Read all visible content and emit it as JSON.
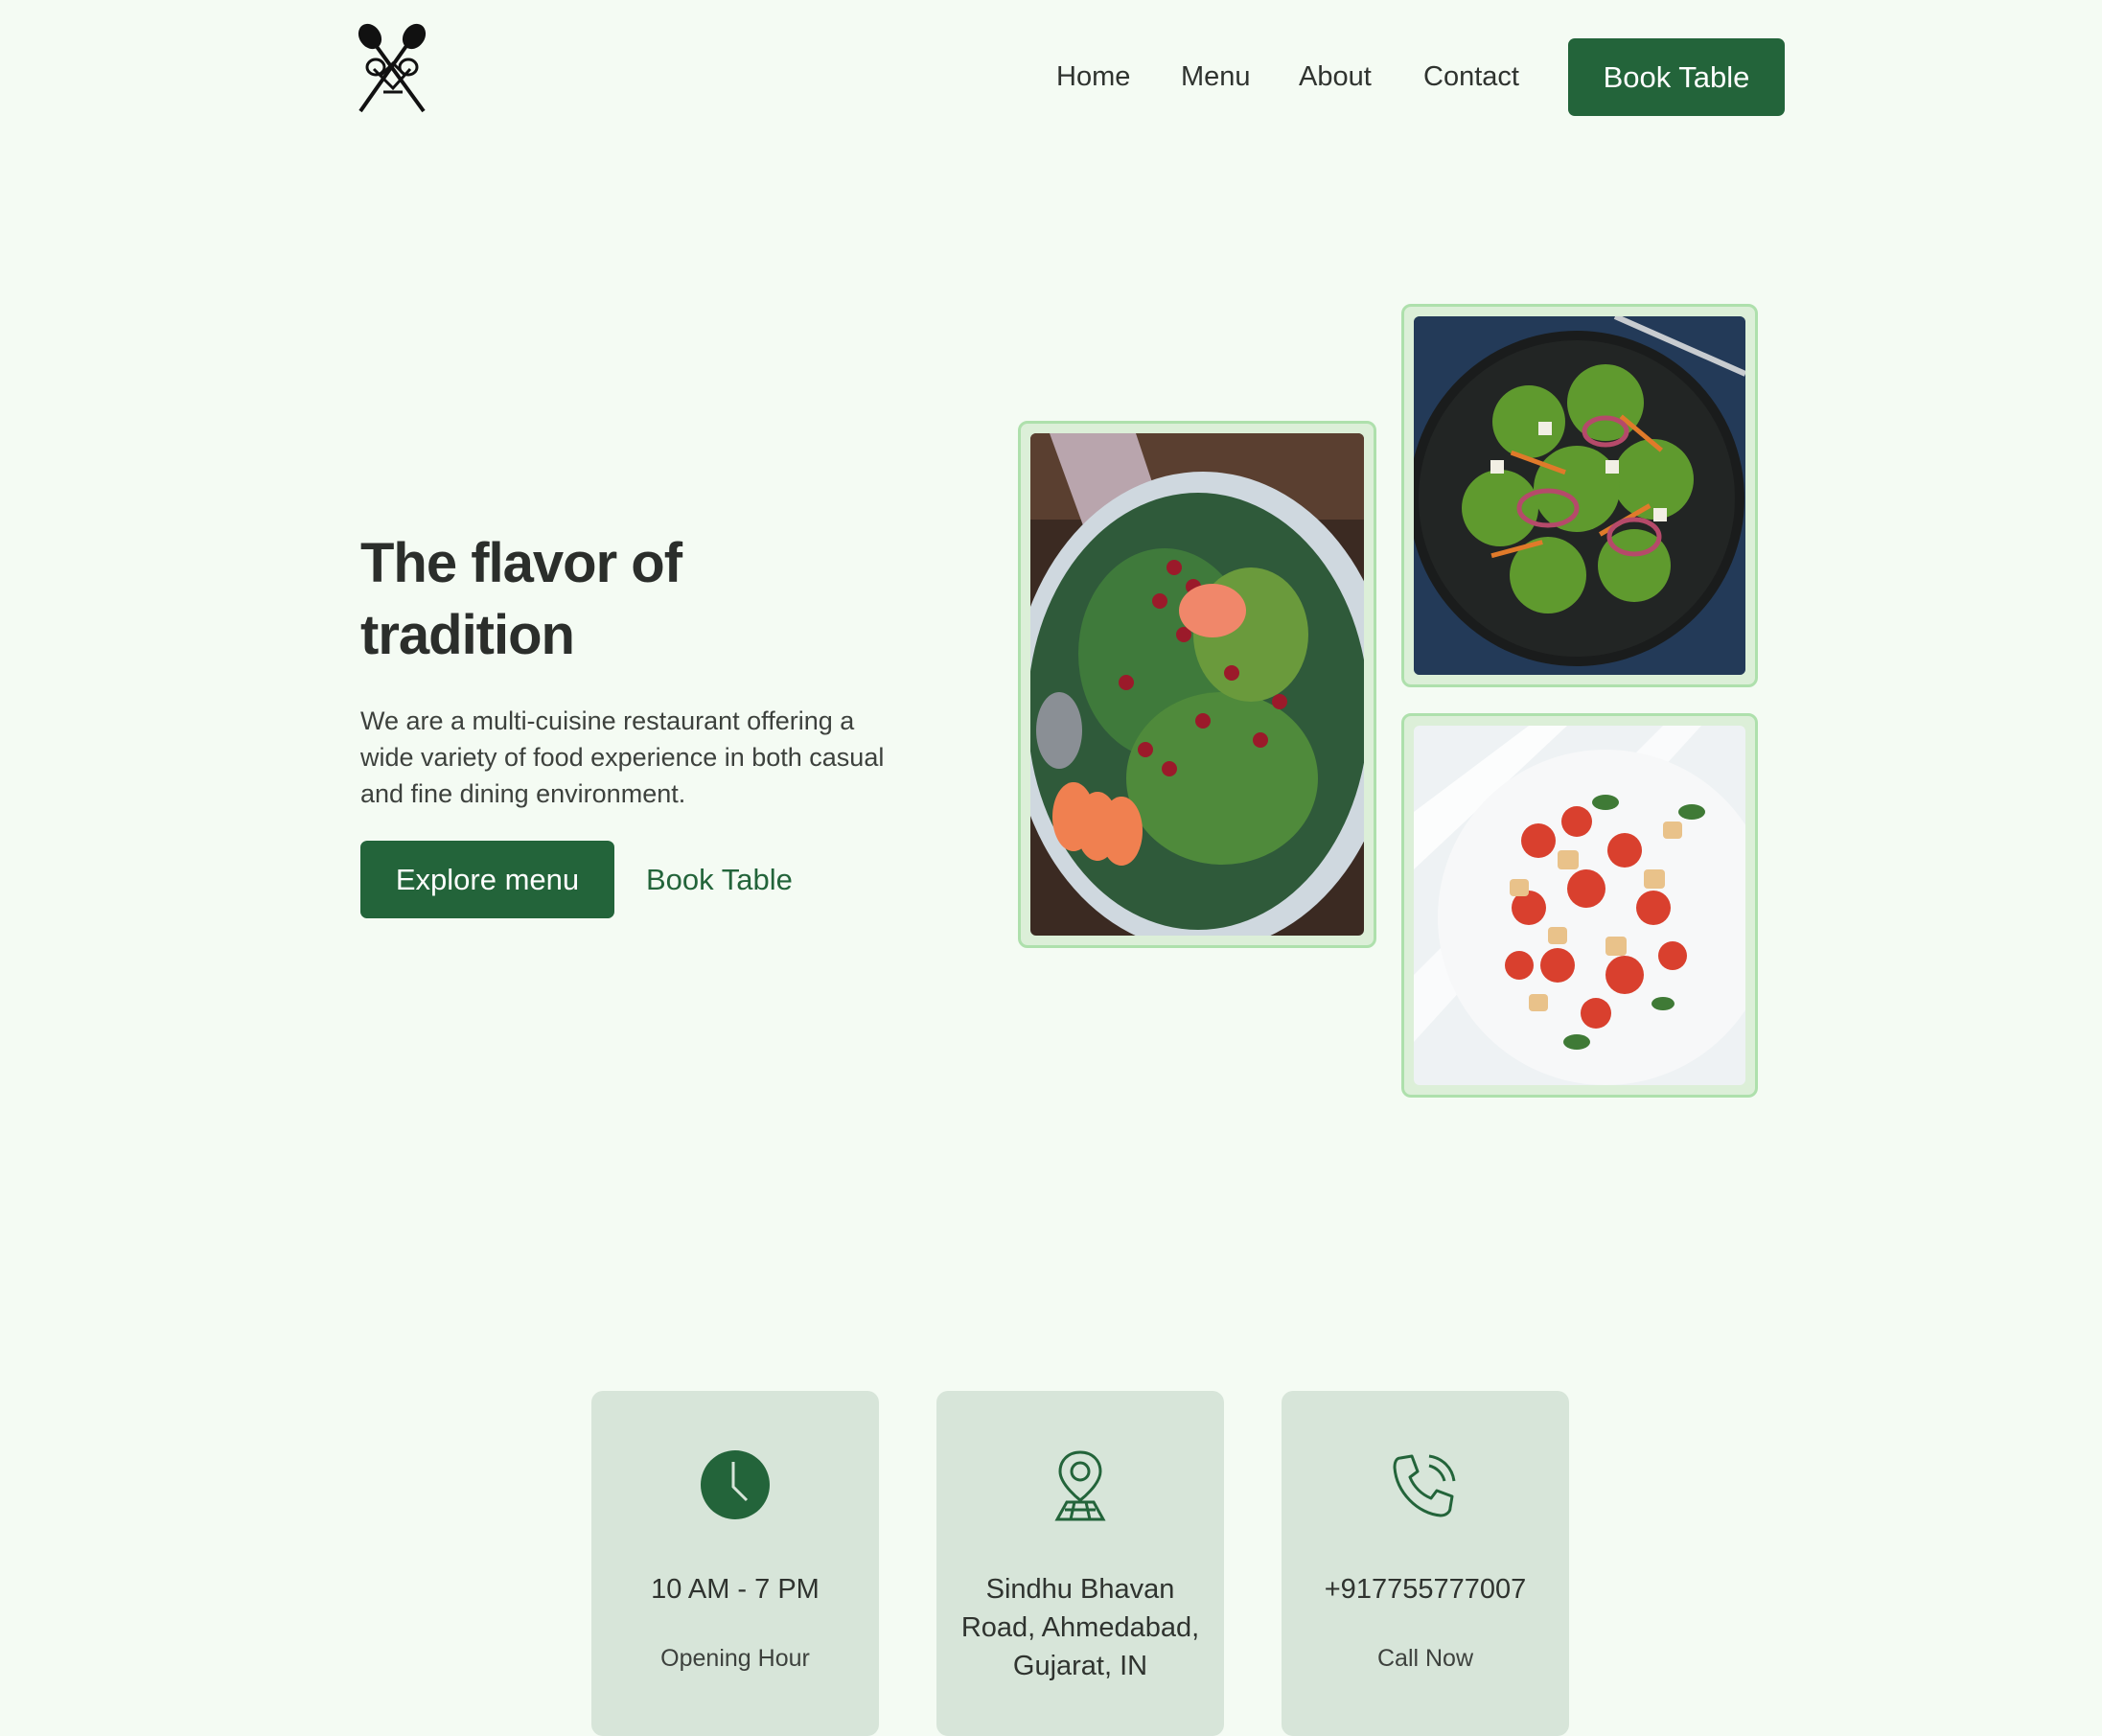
{
  "logo": {
    "icon": "crossed-spoons-logo-icon"
  },
  "nav": {
    "items": [
      "Home",
      "Menu",
      "About",
      "Contact"
    ],
    "book_label": "Book Table"
  },
  "hero": {
    "title": "The flavor of tradition",
    "description": "We are a multi-cuisine restaurant offering a wide variety of food experience in both casual and fine dining environment.",
    "explore_label": "Explore menu",
    "book_label": "Book Table"
  },
  "photos": [
    {
      "name": "pomegranate-avocado-salad"
    },
    {
      "name": "kale-salad-dark-bowl"
    },
    {
      "name": "tomato-bread-salad"
    }
  ],
  "info_cards": [
    {
      "icon": "clock-icon",
      "title": "10 AM - 7 PM",
      "subtitle": "Opening Hour"
    },
    {
      "icon": "map-pin-icon",
      "title": "Sindhu Bhavan Road, Ahmedabad, Gujarat, IN",
      "subtitle": ""
    },
    {
      "icon": "phone-call-icon",
      "title": "+917755777007",
      "subtitle": "Call Now"
    }
  ],
  "colors": {
    "background": "#f4fbf3",
    "brand_green": "#23643a",
    "card_bg": "#d7e5d9",
    "photo_border": "#aee0ac"
  }
}
